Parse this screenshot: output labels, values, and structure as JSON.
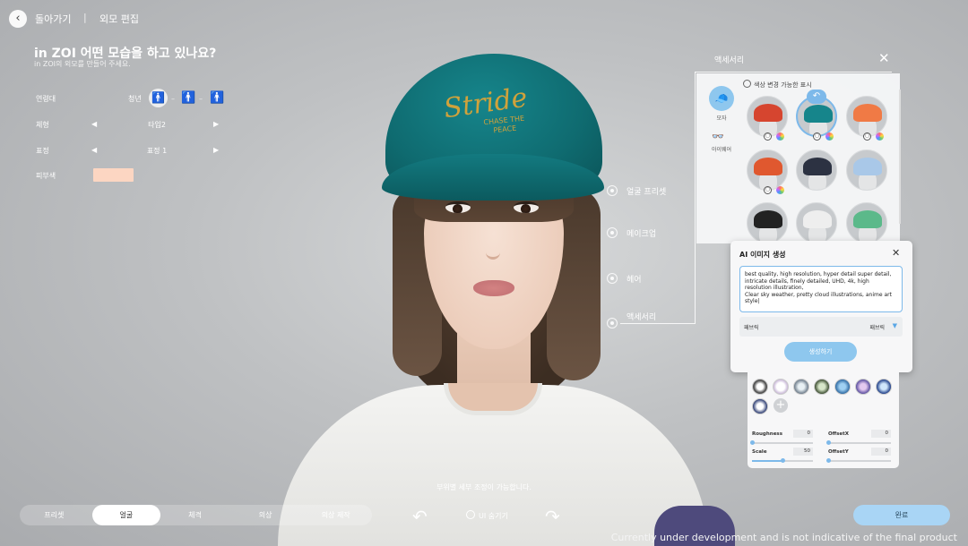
{
  "topbar": {
    "back_label": "돌아가기",
    "separator": "|",
    "title": "외모 편집"
  },
  "question": {
    "title": "in ZOI 어떤 모습을 하고 있나요?",
    "subtitle": "in ZOI의 외모를 만들어 주세요."
  },
  "attributes": {
    "age": {
      "label": "연령대",
      "value": "청년",
      "dash": "–"
    },
    "body": {
      "label": "체형",
      "value": "타입2"
    },
    "expression": {
      "label": "표정",
      "value": "표정 1"
    },
    "skin": {
      "label": "피부색",
      "color": "#fcd6c2"
    }
  },
  "arrows": {
    "left": "◀",
    "right": "▶"
  },
  "categories": [
    "얼굴 프리셋",
    "메이크업",
    "헤어",
    "액세서리"
  ],
  "character": {
    "cap_text": "Stride",
    "cap_subtext": "CHASE THE\nPEACE"
  },
  "accessory": {
    "title": "액세서리",
    "close": "✕",
    "color_option": "색상 변경 가능한 표시",
    "tabs": [
      {
        "label": "모자",
        "icon": "hat-icon"
      },
      {
        "label": "아이웨어",
        "icon": "glasses-icon"
      }
    ],
    "undo_icon": "↶",
    "items": [
      {
        "name": "red-cap",
        "color": "#d6452f"
      },
      {
        "name": "teal-cap",
        "color": "#16858b"
      },
      {
        "name": "orange-cap",
        "color": "#f07a45"
      },
      {
        "name": "orange-dark-cap",
        "color": "#e0582f"
      },
      {
        "name": "navy-bucket-hat",
        "color": "#2c3242"
      },
      {
        "name": "blue-checker-bucket-hat",
        "color": "#a9c8e8"
      },
      {
        "name": "black-checker-bucket-hat",
        "color": "#222222"
      },
      {
        "name": "white-bucket-hat",
        "color": "#eeeeee"
      },
      {
        "name": "green-checker-bucket-hat",
        "color": "#5bb98a"
      }
    ]
  },
  "ai_dialog": {
    "title": "AI 이미지 생성",
    "close": "✕",
    "prompt": "best quality, high resolution, hyper detail super detail, intricate details, finely detailed, UHD, 4k, high resolution illustration,\nClear sky weather, pretty cloud illustrations, anime art style|",
    "row_label": "패브릭",
    "row_value": "패브릭",
    "row_caret": "▼",
    "generate_button": "생성하기"
  },
  "texture_panel": {
    "add": "+",
    "params": [
      {
        "label": "Roughness",
        "value": "0",
        "fill": 0
      },
      {
        "label": "OffsetX",
        "value": "0",
        "fill": 0
      },
      {
        "label": "Scale",
        "value": "50",
        "fill": 0.5
      },
      {
        "label": "OffsetY",
        "value": "0",
        "fill": 0
      }
    ]
  },
  "hint": "부위별 세부 조정이 가능합니다.",
  "bottom_tabs": [
    "프리셋",
    "얼굴",
    "체격",
    "의상",
    "의상 제작"
  ],
  "active_tab": "얼굴",
  "rotate_left_icon": "↶",
  "rotate_right_icon": "↷",
  "hide_ui": "UI 숨기기",
  "done_button": "완료",
  "disclaimer": "Currently under development and is not indicative of the final product"
}
